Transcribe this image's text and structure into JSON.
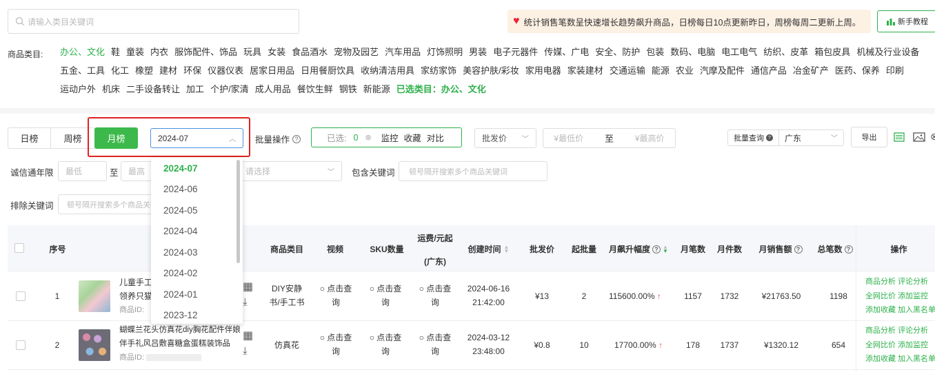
{
  "search": {
    "placeholder": "请输入类目关键词"
  },
  "notice": {
    "text": "统计销售笔数呈快速增长趋势飙升商品，日榜每日10点更新昨日，周榜每周二更新上周。"
  },
  "tutorial": {
    "label": "新手教程"
  },
  "categories": {
    "label": "商品类目:",
    "items": [
      "办公、文化",
      "鞋",
      "童装",
      "内衣",
      "服饰配件、饰品",
      "玩具",
      "女装",
      "食品酒水",
      "宠物及园艺",
      "汽车用品",
      "灯饰照明",
      "男装",
      "电子元器件",
      "传媒、广电",
      "安全、防护",
      "包装",
      "数码、电脑",
      "电工电气",
      "纺织、皮革",
      "箱包皮具",
      "机械及行业设备",
      "五金、工具",
      "化工",
      "橡塑",
      "建材",
      "环保",
      "仪器仪表",
      "居家日用品",
      "日用餐厨饮具",
      "收纳清洁用具",
      "家纺家饰",
      "美容护肤/彩妆",
      "家用电器",
      "家装建材",
      "交通运输",
      "能源",
      "农业",
      "汽摩及配件",
      "通信产品",
      "冶金矿产",
      "医药、保养",
      "印刷",
      "运动户外",
      "机床",
      "二手设备转让",
      "加工",
      "个护/家清",
      "成人用品",
      "餐饮生鲜",
      "钢铁",
      "新能源"
    ],
    "selected_prefix": "已选类目：",
    "selected_value": "办公、文化"
  },
  "tabs": {
    "daily": "日榜",
    "weekly": "周榜",
    "monthly": "月榜"
  },
  "period": {
    "value": "2024-07",
    "options": [
      "2024-07",
      "2024-06",
      "2024-05",
      "2024-04",
      "2024-03",
      "2024-02",
      "2024-01",
      "2023-12"
    ]
  },
  "batch": {
    "label": "批量操作",
    "selected_label": "已选:",
    "selected_count": "0",
    "monitor": "监控",
    "collect": "收藏",
    "compare": "对比"
  },
  "price_type": {
    "value": "批发价"
  },
  "price_range": {
    "min_placeholder": "¥最低价",
    "to": "至",
    "max_placeholder": "¥最高价"
  },
  "batch_query": {
    "label": "批量查询",
    "region": "广东",
    "export": "导出"
  },
  "filters": {
    "years_label": "诚信通年限",
    "years_min": "最低",
    "to": "至",
    "years_max": "最高",
    "select_placeholder": "请选择",
    "include_label": "包含关键词",
    "include_placeholder": "顿号隔开搜索多个商品关键词",
    "exclude_label": "排除关键词",
    "exclude_placeholder": "顿号隔开搜索多个商品关键词"
  },
  "table": {
    "headers": {
      "index": "序号",
      "category": "商品类目",
      "video": "视频",
      "sku": "SKU数量",
      "shipping_1": "运费/元起",
      "shipping_2": "(广东)",
      "created": "创建时间",
      "price": "批发价",
      "moq": "起批量",
      "growth": "月飙升幅度",
      "orders": "月笔数",
      "pieces": "月件数",
      "sales": "月销售额",
      "total": "总笔数",
      "ops": "操作"
    },
    "query_text_1": "点击查",
    "query_text_2": "询",
    "product_id_label": "商品ID:",
    "ops": {
      "analysis": "商品分析",
      "review": "评论分析",
      "compare": "全网比价",
      "monitor": "添加监控",
      "collect": "添加收藏",
      "blacklist": "加入黑名单"
    },
    "rows": [
      {
        "index": "1",
        "title_1": "儿童手工",
        "title_2": "领养只猫",
        "category_1": "DIY安静",
        "category_2": "书/手工书",
        "date": "2024-06-16",
        "time": "21:42:00",
        "price": "¥13",
        "moq": "2",
        "growth": "115600.00%",
        "orders": "1157",
        "pieces": "1732",
        "sales": "¥21763.50",
        "total": "1198"
      },
      {
        "index": "2",
        "title_1": "蝴蝶兰花头仿真花diy胸花配件伴娘",
        "title_2": "伴手礼风吕敷喜糖盒蛋糕装饰品",
        "category_1": "仿真花",
        "category_2": "",
        "date": "2024-03-12",
        "time": "23:48:00",
        "price": "¥0.8",
        "moq": "10",
        "growth": "17700.00%",
        "orders": "178",
        "pieces": "1737",
        "sales": "¥1320.12",
        "total": "654"
      }
    ]
  },
  "colors": {
    "accent": "#2db14b",
    "highlight_box": "#e02020",
    "up_arrow": "#e44"
  }
}
